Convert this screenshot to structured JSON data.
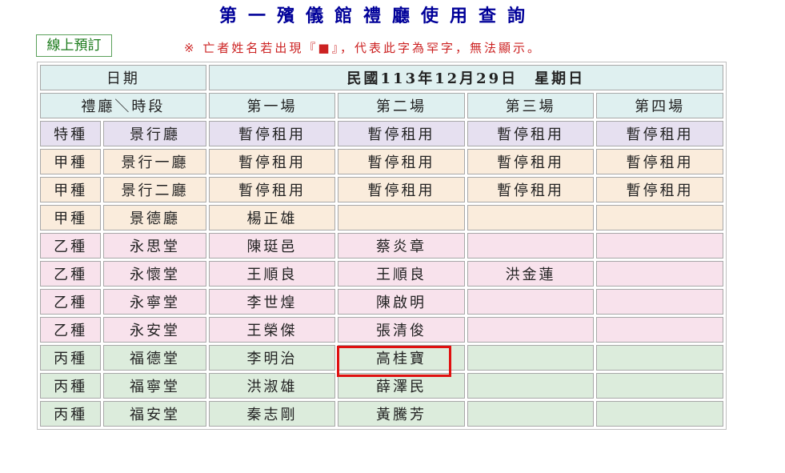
{
  "page": {
    "title": "第一殯儀館禮廳使用查詢",
    "online_booking_label": "線上預訂",
    "notice": "※ 亡者姓名若出現『■』，代表此字為罕字，無法顯示。"
  },
  "table": {
    "date_header": "日期",
    "date_value": "民國113年12月29日　星期日",
    "hall_session_header": "禮廳＼時段",
    "sessions": [
      "第一場",
      "第二場",
      "第三場",
      "第四場"
    ],
    "rows": [
      {
        "grade": "特種",
        "hall": "景行廳",
        "cells": [
          "暫停租用",
          "暫停租用",
          "暫停租用",
          "暫停租用"
        ]
      },
      {
        "grade": "甲種",
        "hall": "景行一廳",
        "cells": [
          "暫停租用",
          "暫停租用",
          "暫停租用",
          "暫停租用"
        ]
      },
      {
        "grade": "甲種",
        "hall": "景行二廳",
        "cells": [
          "暫停租用",
          "暫停租用",
          "暫停租用",
          "暫停租用"
        ]
      },
      {
        "grade": "甲種",
        "hall": "景德廳",
        "cells": [
          "楊正雄",
          "",
          "",
          ""
        ]
      },
      {
        "grade": "乙種",
        "hall": "永思堂",
        "cells": [
          "陳珽邑",
          "蔡炎章",
          "",
          ""
        ]
      },
      {
        "grade": "乙種",
        "hall": "永懷堂",
        "cells": [
          "王順良",
          "王順良",
          "洪金蓮",
          ""
        ]
      },
      {
        "grade": "乙種",
        "hall": "永寧堂",
        "cells": [
          "李世煌",
          "陳啟明",
          "",
          ""
        ]
      },
      {
        "grade": "乙種",
        "hall": "永安堂",
        "cells": [
          "王榮傑",
          "張清俊",
          "",
          ""
        ]
      },
      {
        "grade": "丙種",
        "hall": "福德堂",
        "cells": [
          "李明治",
          "高桂寶",
          "",
          ""
        ]
      },
      {
        "grade": "丙種",
        "hall": "福寧堂",
        "cells": [
          "洪淑雄",
          "薛澤民",
          "",
          ""
        ]
      },
      {
        "grade": "丙種",
        "hall": "福安堂",
        "cells": [
          "秦志剛",
          "黃騰芳",
          "",
          ""
        ]
      }
    ]
  },
  "colors": {
    "title": "#000099",
    "notice": "#cc2222",
    "header_bg": "#dff0f0",
    "special_bg": "#e6e0f0",
    "grade_a_bg": "#faecdc",
    "grade_b_bg": "#f8e2ec",
    "grade_c_bg": "#dcecdc",
    "highlight_border": "#e01010"
  }
}
